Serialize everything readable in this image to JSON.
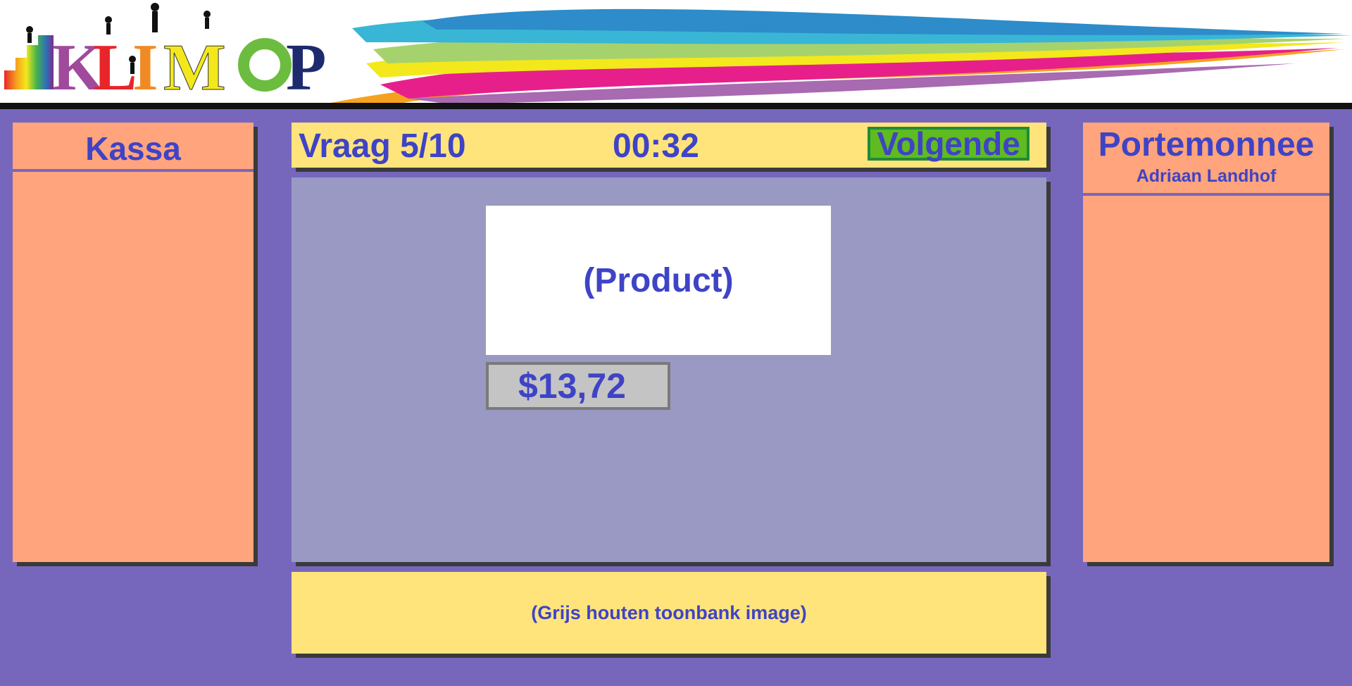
{
  "header": {
    "logo_text": "KLIMOP"
  },
  "kassa": {
    "title": "Kassa"
  },
  "topbar": {
    "question": "Vraag 5/10",
    "timer": "00:32",
    "next_label": "Volgende"
  },
  "stage": {
    "product_placeholder": "(Product)",
    "price": "$13,72"
  },
  "counter": {
    "placeholder": "(Grijs houten toonbank image)"
  },
  "wallet": {
    "title": "Portemonnee",
    "owner": "Adriaan Landhof"
  },
  "colors": {
    "background": "#7667bd",
    "panel": "#ffa47c",
    "bar": "#ffe47c",
    "stage": "#9999c3",
    "text": "#3f43c6",
    "next_button": "#5fbb1f"
  }
}
